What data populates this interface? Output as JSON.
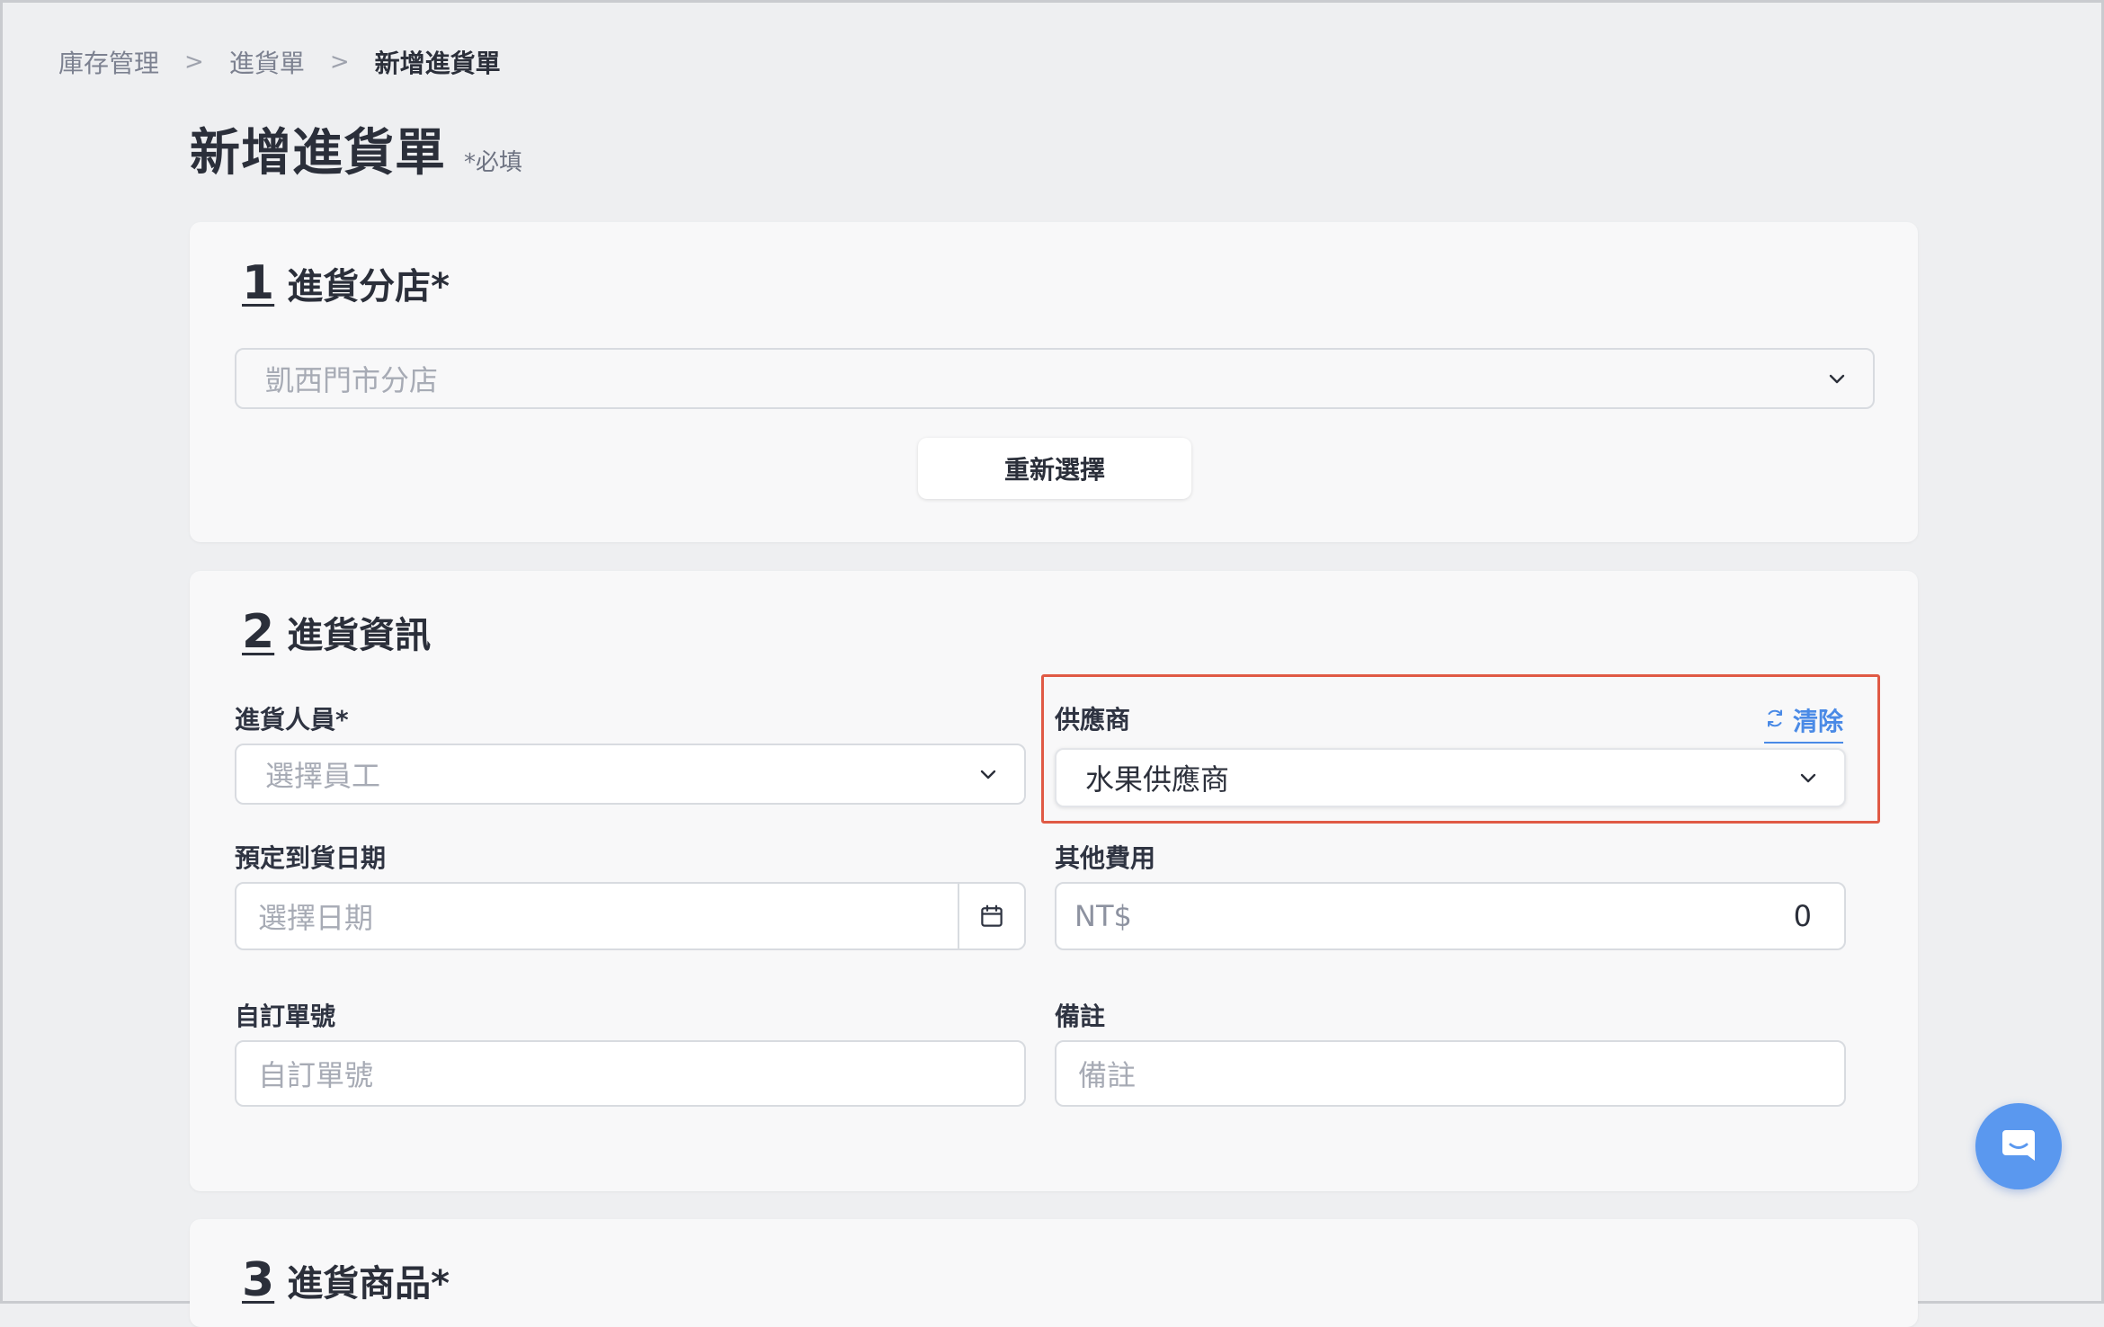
{
  "breadcrumb": {
    "items": [
      "庫存管理",
      "進貨單",
      "新增進貨單"
    ],
    "separator": ">"
  },
  "page": {
    "title": "新增進貨單",
    "required_note": "*必填"
  },
  "section1": {
    "number": "1",
    "title": "進貨分店*",
    "branch_select": {
      "value": "凱西門市分店",
      "disabled": true
    },
    "reselect_label": "重新選擇"
  },
  "section2": {
    "number": "2",
    "title": "進貨資訊",
    "staff": {
      "label": "進貨人員*",
      "placeholder": "選擇員工"
    },
    "supplier": {
      "label": "供應商",
      "clear_label": "清除",
      "value": "水果供應商",
      "highlight_color": "#e05a45"
    },
    "arrival_date": {
      "label": "預定到貨日期",
      "placeholder": "選擇日期"
    },
    "other_fee": {
      "label": "其他費用",
      "currency": "NT$",
      "value": "0"
    },
    "custom_number": {
      "label": "自訂單號",
      "placeholder": "自訂單號"
    },
    "note": {
      "label": "備註",
      "placeholder": "備註"
    }
  },
  "section3": {
    "number": "3",
    "title": "進貨商品*"
  },
  "colors": {
    "accent": "#4a8ae6",
    "chat_button": "#5a98ef",
    "background": "#eeeff1",
    "card": "#f8f8f9"
  },
  "icons": {
    "chevron": "chevron-down-icon",
    "calendar": "calendar-icon",
    "refresh": "refresh-icon",
    "chat": "chat-icon"
  }
}
